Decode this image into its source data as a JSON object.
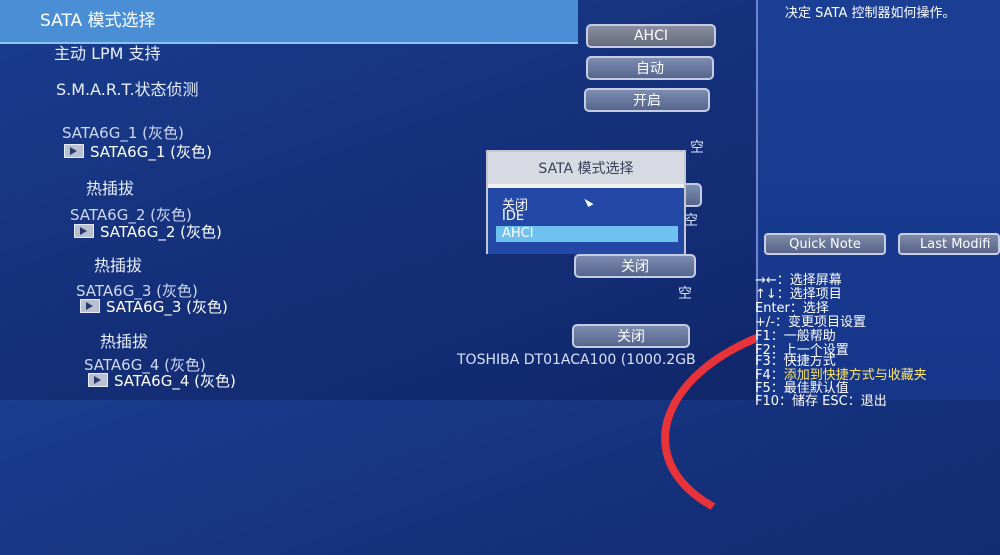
{
  "header": {
    "sata_mode_label": "SATA 模式选择"
  },
  "settings": [
    {
      "label": "主动 LPM 支持",
      "value": "自动"
    },
    {
      "label": "S.M.A.R.T.状态侦测",
      "value": "开启"
    }
  ],
  "sata_mode_value": "AHCI",
  "ports": [
    {
      "title": "SATA6G_1 (灰色)",
      "device": "SATA6G_1 (灰色)",
      "status": "空",
      "hotplug_label": "热插拔",
      "hotplug_value": ""
    },
    {
      "title": "SATA6G_2 (灰色)",
      "device": "SATA6G_2 (灰色)",
      "status": "空",
      "hotplug_label": "热插拔",
      "hotplug_value": "关闭"
    },
    {
      "title": "SATA6G_3 (灰色)",
      "device": "SATA6G_3 (灰色)",
      "status": "空",
      "hotplug_label": "热插拔",
      "hotplug_value": "关闭"
    },
    {
      "title": "SATA6G_4 (灰色)",
      "device": "SATA6G_4 (灰色)",
      "status": "TOSHIBA DT01ACA100 (1000.2GB",
      "hotplug_label": "",
      "hotplug_value": ""
    }
  ],
  "popup": {
    "title": "SATA 模式选择",
    "options": [
      "关闭",
      "IDE",
      "AHCI"
    ],
    "selected": "AHCI"
  },
  "right": {
    "description": "决定 SATA 控制器如何操作。",
    "quick_note": "Quick Note",
    "last_modified": "Last Modifi",
    "help": [
      {
        "text": "→←：选择屏幕"
      },
      {
        "text": "↑↓：选择项目"
      },
      {
        "text": "Enter：选择"
      },
      {
        "text": "+/-：变更项目设置"
      },
      {
        "text": "F1：一般帮助"
      },
      {
        "text": "F2：上一个设置"
      },
      {
        "text": "F3：快捷方式"
      },
      {
        "prefix": "F4：",
        "highlight": "添加到快捷方式与收藏夹"
      },
      {
        "text": "F5：最佳默认值"
      },
      {
        "text": "F10：储存  ESC：退出"
      }
    ]
  },
  "colors": {
    "background": "#15307a",
    "selection_bar": "#4a8fd6",
    "popup_highlight": "#6fc2f0",
    "annotation": "#e8333a",
    "help_highlight": "#ffe56a"
  }
}
